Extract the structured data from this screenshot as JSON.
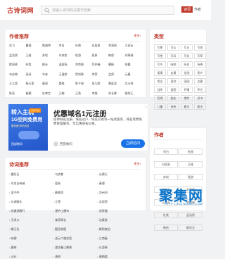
{
  "header": {
    "logo": "古诗词网",
    "search_placeholder": "请输入诗词的关键字检索",
    "nav": [
      "诗词",
      "作者",
      "名句",
      "古籍"
    ]
  },
  "authors_card": {
    "title": "作者推荐",
    "more": "更多>",
    "items": [
      "岳飞",
      "曹操",
      "陶渊明",
      "李白",
      "杜甫",
      "白居易",
      "李清照",
      "王安石",
      "孟浩然",
      "王维",
      "苏轼",
      "辛弃疾",
      "陆游",
      "屈原",
      "韩愈",
      "刘禹锡",
      "欧阳修",
      "杜牧",
      "柳永",
      "温庭筠",
      "李商隐",
      "范仲淹",
      "曹植",
      "张籍",
      "韦应物",
      "高适",
      "岑参",
      "王昌龄",
      "贺知章",
      "李贺",
      "孟郊",
      "元稹",
      "王之涣",
      "杨万里",
      "秦观",
      "晏殊",
      "陈子昂",
      "张九龄",
      "黄庭坚",
      "文天祥",
      "陈亮",
      "崔颢",
      "杜审言",
      "王翰",
      "王勃",
      "李煜",
      "刘长卿",
      "骆宾王"
    ]
  },
  "types_card": {
    "title": "类型",
    "items": [
      "写景",
      "写山",
      "写水",
      "写雨",
      "写雪",
      "写风",
      "写花",
      "写草",
      "写鸟",
      "咏物",
      "咏史",
      "咏梅",
      "爱情",
      "友情",
      "送别",
      "思乡",
      "思念",
      "离别",
      "田园",
      "边塞",
      "战争",
      "爱国",
      "抒情",
      "怀古",
      "哲理",
      "励志",
      "惜时",
      "读书",
      "儿童",
      "母亲",
      "春天",
      "夏天"
    ]
  },
  "ad": {
    "left_line1": "转入主机",
    "left_line2": "1G空间免费用",
    "left_line3": "服务器 即刻出发",
    "badge": "多款产品",
    "left_brand": "西部数码",
    "title": "优惠域名1元注册",
    "desc": "提供域名注册、域名过户、域名交易等一站式服务，域名续费免费管理服务，享实惠域名价格。",
    "brand": "西部数码",
    "button": "立即访问",
    "close": "×"
  },
  "authors_side": {
    "title": "作者",
    "items": [
      "李白",
      "杜甫",
      "白居易",
      "王维",
      "苏轼",
      "陆游",
      "辛弃疾",
      "李清照",
      "王安石",
      "刘禹锡",
      "杜牧",
      "孟浩然",
      "韩愈",
      "柳宗元"
    ]
  },
  "poems_card": {
    "title": "诗词推荐",
    "more": "更多>",
    "items": [
      "重阳日",
      "乌衣巷",
      "长歌行",
      "早发白帝城",
      "登高",
      "春望",
      "游子吟",
      "静夜思",
      "凉州词",
      "水调歌头",
      "江雪",
      "念奴娇",
      "钱塘湖春行",
      "望庐山瀑布",
      "渔家傲",
      "天净沙",
      "夜雨寄北",
      "泊秦淮",
      "赠汪伦",
      "题西林壁",
      "枫桥夜泊",
      "咏柳",
      "送元二使安西",
      "江南春",
      "鹿柴",
      "惠崇春江晚景",
      "乐游原",
      "山行",
      "清明",
      "黄鹤楼"
    ]
  },
  "watermark": {
    "text": "聚集网",
    "sub": "HTTP://JUJIWANG.COM"
  },
  "colors": {
    "accent": "#c0392b",
    "ad_blue": "#2456c9",
    "ad_button": "#1a73e8",
    "watermark": "#0b74c9"
  }
}
